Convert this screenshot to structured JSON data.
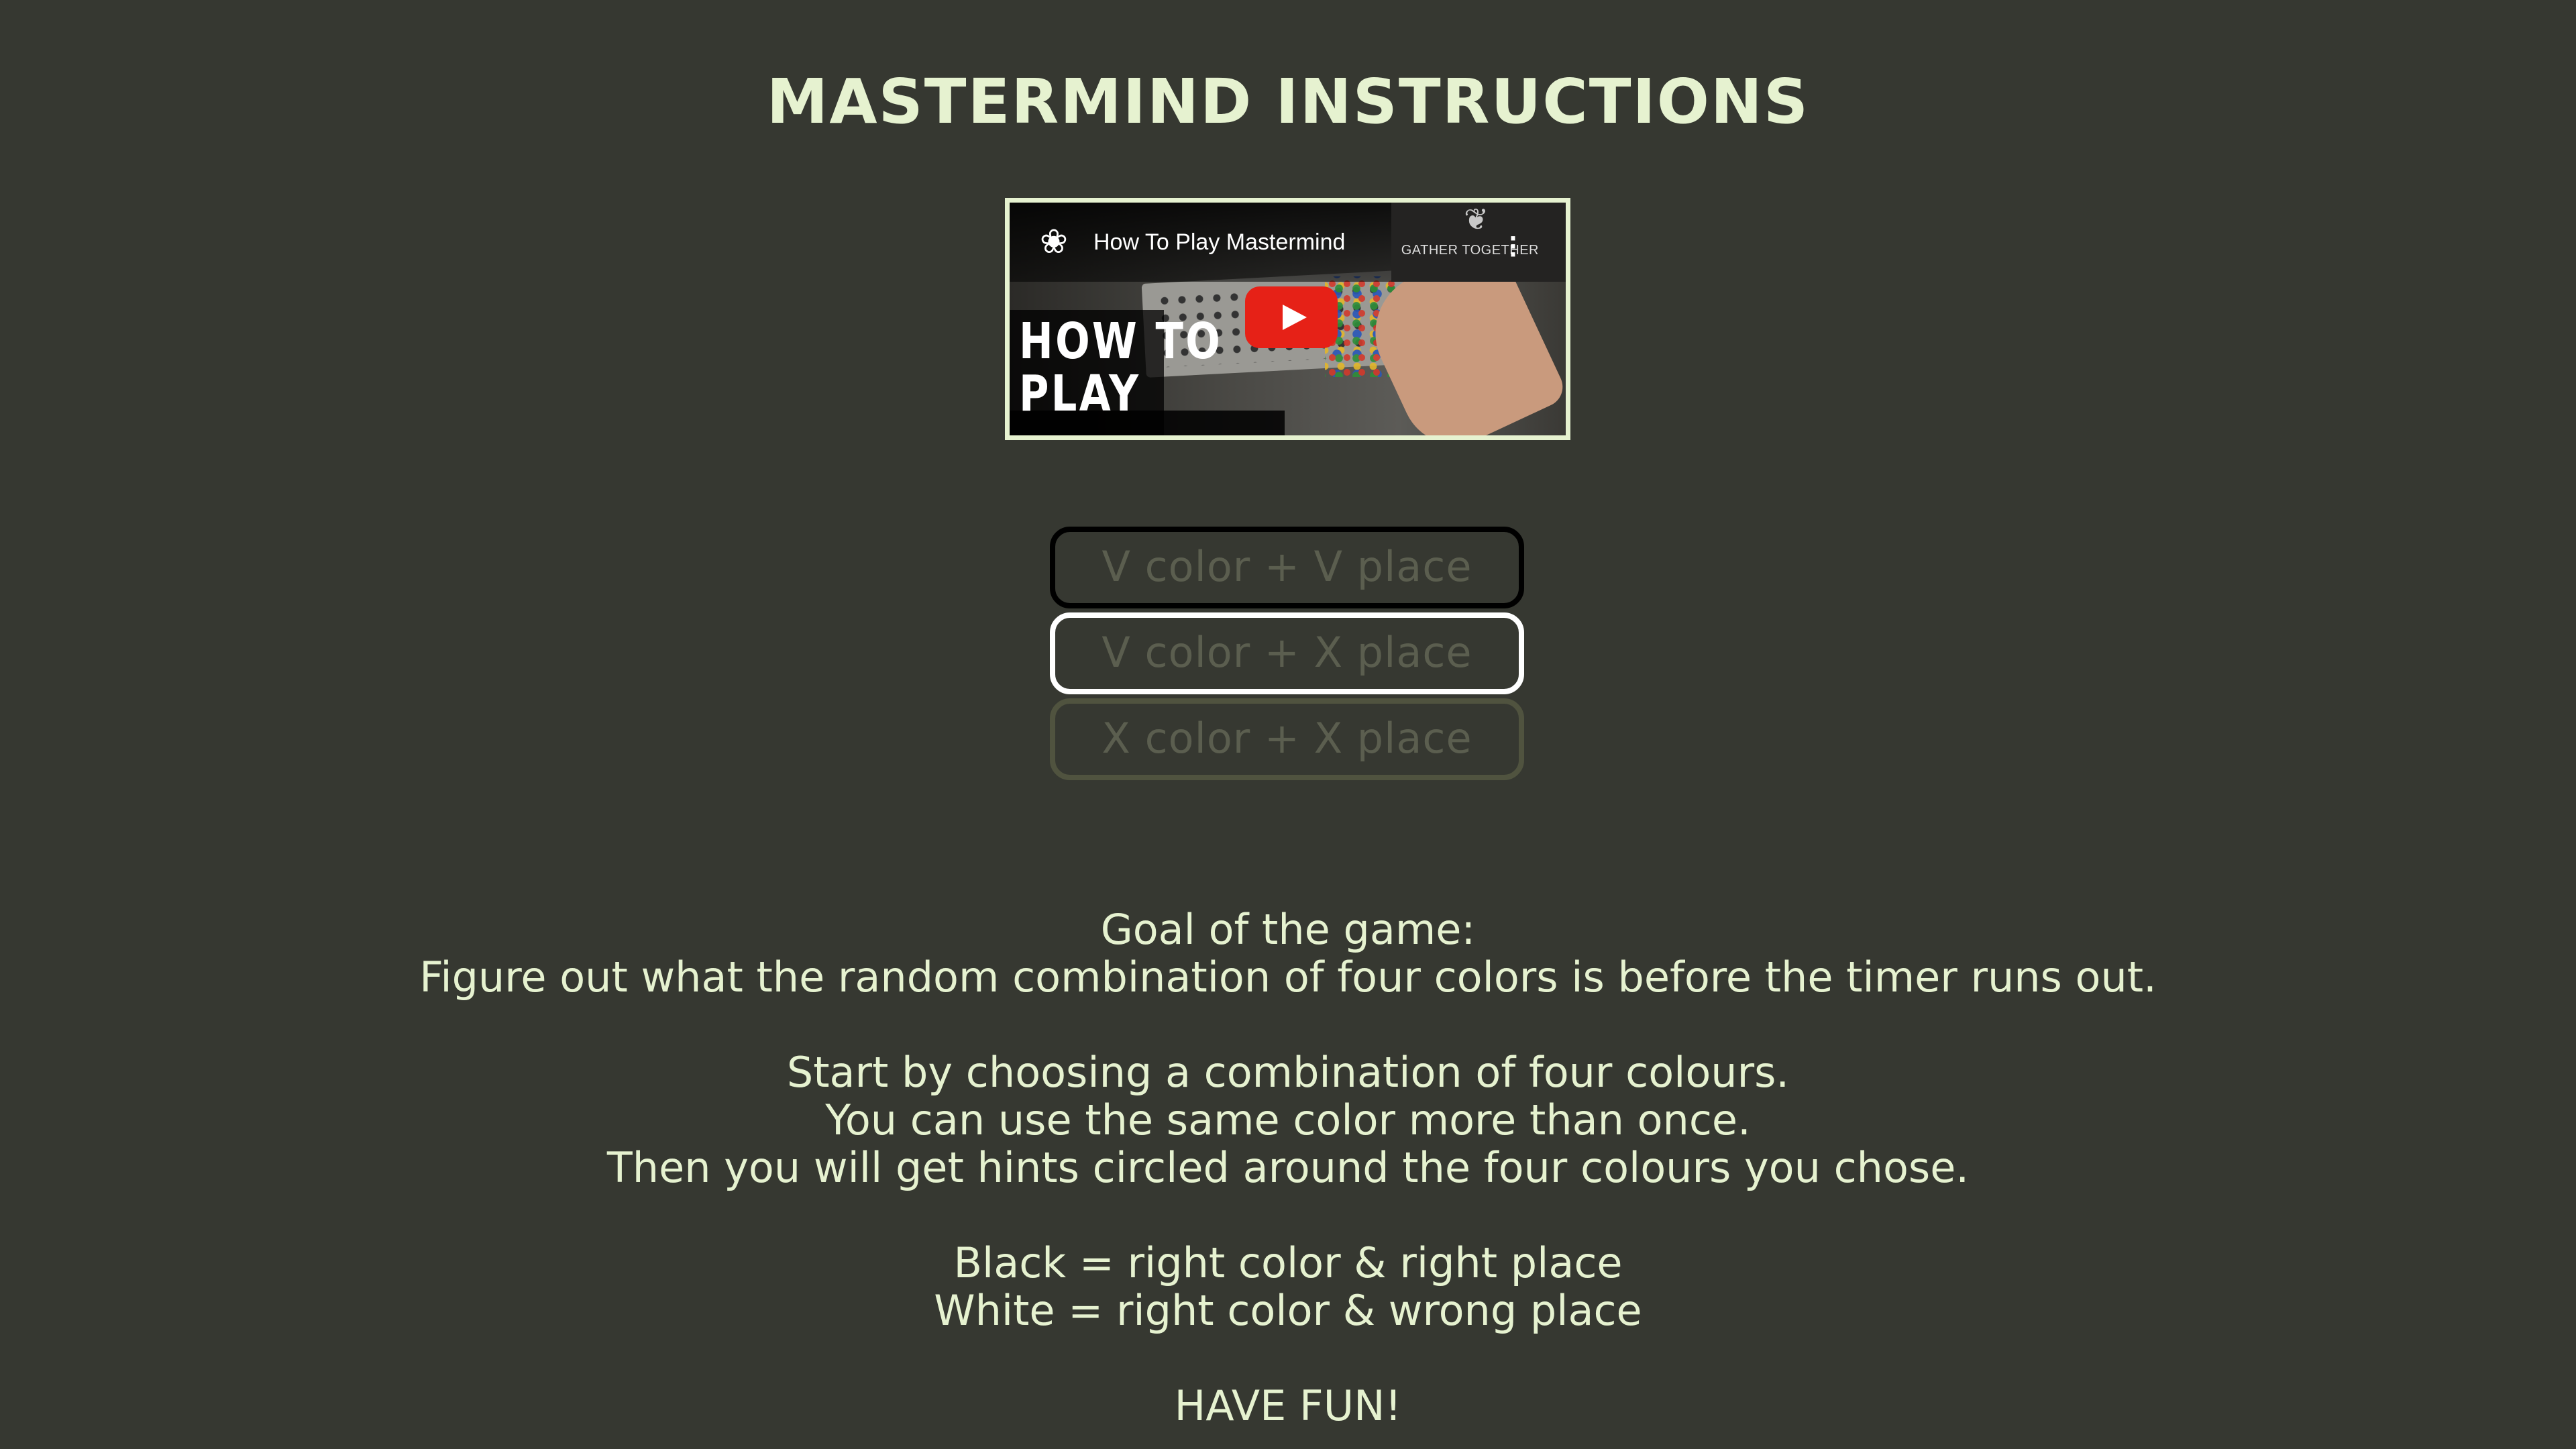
{
  "page": {
    "title": "MASTERMIND INSTRUCTIONS",
    "background_color": "#363831",
    "text_color": "#e6f2d0"
  },
  "video": {
    "title": "How To Play Mastermind",
    "brand": "GATHER TOGETHER",
    "thumbnail_text_line1": "HOW TO",
    "thumbnail_text_line2": "PLAY",
    "icons": [
      "channel-logo-icon",
      "play-icon",
      "more-options-icon"
    ],
    "play_button_color": "#e62117"
  },
  "feedback_legend": [
    {
      "label": "V color + V place",
      "border_color": "#000000"
    },
    {
      "label": "V color + X place",
      "border_color": "#ffffff"
    },
    {
      "label": "X color + X place",
      "border_color": "#50533f"
    }
  ],
  "instructions": {
    "goal_heading": "Goal of the game:",
    "goal_text": "Figure out what the random combination of four colors is before the timer runs out.",
    "step1": "Start by choosing a combination of four colours.",
    "step2": "You can use the same color more than once.",
    "step3": "Then you will get hints circled around the four colours you chose.",
    "black_hint": "Black = right color & right place",
    "white_hint": "White = right color & wrong place",
    "closing": "HAVE FUN!"
  }
}
